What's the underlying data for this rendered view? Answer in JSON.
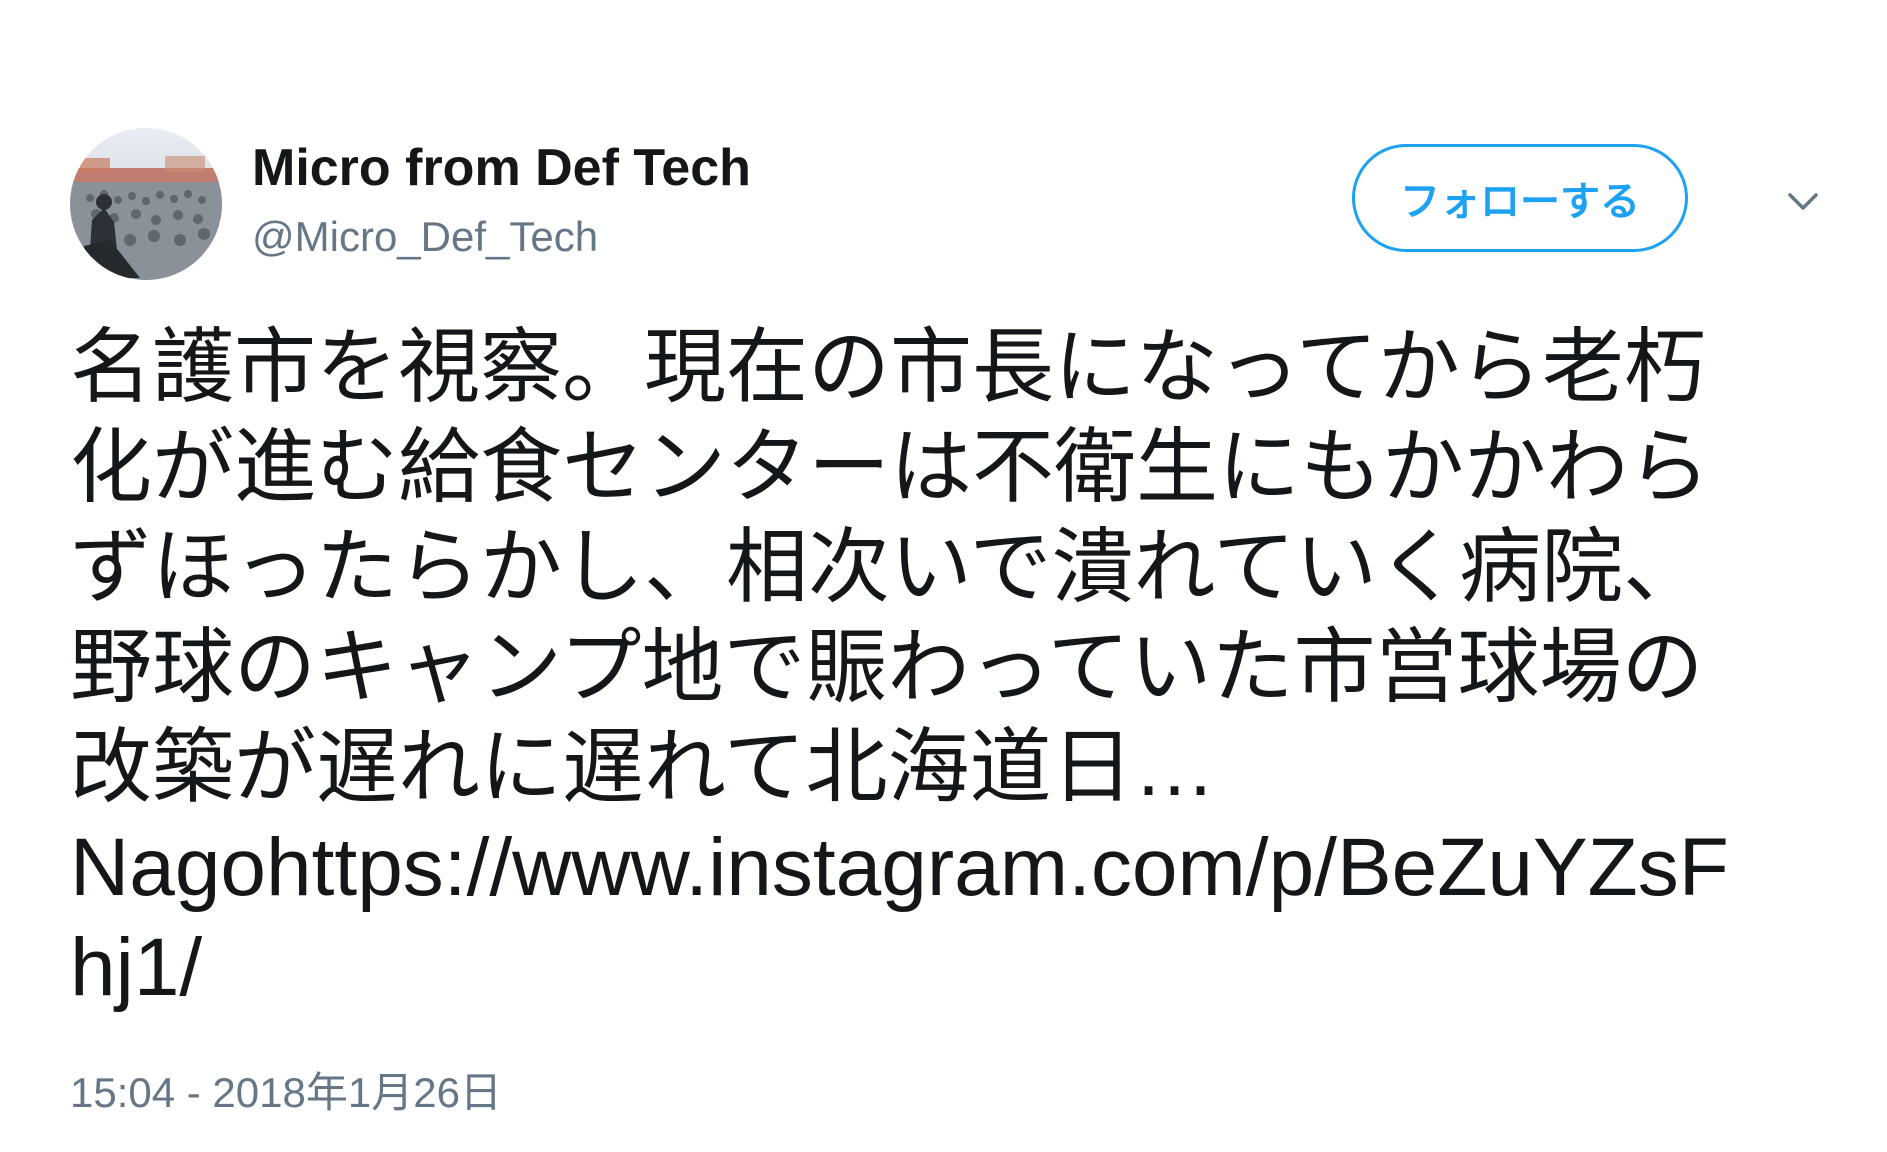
{
  "author": {
    "display_name": "Micro from Def Tech",
    "handle": "@Micro_Def_Tech",
    "avatar_icon": "concert-crowd-avatar"
  },
  "actions": {
    "follow_label": "フォローする",
    "more_icon": "chevron-down-icon"
  },
  "tweet": {
    "lines": [
      "名護市を視察。現在の市長になってから老朽",
      "化が進む給食センターは不衛生にもかかわら",
      "ずほったらかし、相次いで潰れていく病院、",
      "野球のキャンプ地で賑わっていた市営球場の",
      "改築が遅れに遅れて北海道日…"
    ],
    "url_line_1": "Nagohttps://www.instagram.com/p/BeZuYZsF",
    "url_line_2": "hj1/"
  },
  "timestamp": "15:04 - 2018年1月26日",
  "colors": {
    "accent": "#1da1f2",
    "text": "#14171a",
    "secondary": "#657786"
  }
}
